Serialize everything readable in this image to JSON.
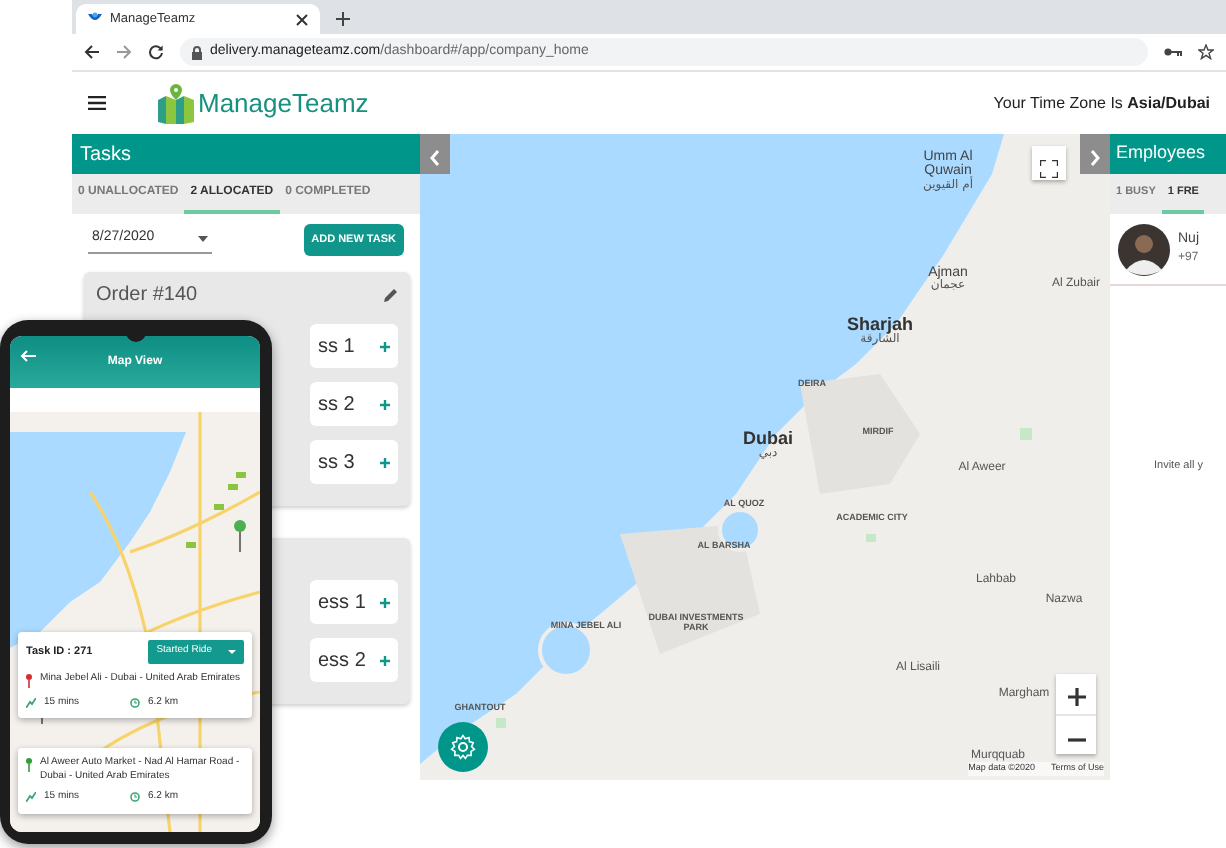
{
  "browser": {
    "tab_title": "ManageTeamz",
    "address_domain": "delivery.manageteamz.com",
    "address_path": "/dashboard#/app/company_home"
  },
  "header": {
    "logo_text": "ManageTeamz",
    "timezone": "Your Time Zone Is **Asia/Dubai**"
  },
  "tasks": {
    "title": "Tasks",
    "tabs": [
      {
        "label": "0 UNALLOCATED",
        "selected": false
      },
      {
        "label": "2 ALLOCATED",
        "selected": true
      },
      {
        "label": "0 COMPLETED",
        "selected": false
      }
    ],
    "date": "8/27/2020",
    "add_button": "ADD NEW TASK",
    "orders": [
      {
        "title": "Order #140",
        "addresses": [
          "ss 1",
          "ss 2",
          "ss 3"
        ]
      },
      {
        "addresses": [
          "ess 1",
          "ess 2"
        ]
      }
    ]
  },
  "map": {
    "labels": [
      {
        "text": "Umm Al Quwain",
        "arabic": "أم القيوين",
        "kind": "town"
      },
      {
        "text": "Ajman",
        "arabic": "عجمان",
        "kind": "town"
      },
      {
        "text": "Al Zubair",
        "kind": "small"
      },
      {
        "text": "Sharjah",
        "arabic": "الشارقة",
        "kind": "city"
      },
      {
        "text": "DEIRA",
        "kind": "district"
      },
      {
        "text": "Dubai",
        "arabic": "دبي",
        "kind": "city"
      },
      {
        "text": "MIRDIF",
        "kind": "district"
      },
      {
        "text": "Al Aweer",
        "kind": "small"
      },
      {
        "text": "AL QUOZ",
        "kind": "district"
      },
      {
        "text": "ACADEMIC CITY",
        "kind": "district"
      },
      {
        "text": "AL BARSHA",
        "kind": "district"
      },
      {
        "text": "MINA JEBEL ALI",
        "kind": "district"
      },
      {
        "text": "DUBAI INVESTMENTS PARK",
        "kind": "district"
      },
      {
        "text": "Lahbab",
        "kind": "small"
      },
      {
        "text": "Nazwa",
        "kind": "small"
      },
      {
        "text": "Al Lisaili",
        "kind": "small"
      },
      {
        "text": "Margham",
        "kind": "small"
      },
      {
        "text": "GHANTOUT",
        "kind": "district"
      },
      {
        "text": "Murqquab",
        "kind": "small"
      }
    ],
    "attribution": "Map data ©2020",
    "terms": "Terms of Use"
  },
  "employees": {
    "title": "Employees",
    "tabs": [
      {
        "label": "1 BUSY",
        "selected": false
      },
      {
        "label": "1 FRE",
        "selected": true
      }
    ],
    "list": [
      {
        "name": "Nuj",
        "phone": "+97"
      }
    ],
    "invite": "Invite all y"
  },
  "phone": {
    "title": "Map View",
    "task_id": "Task ID : 271",
    "status": "Started Ride",
    "stops": [
      {
        "address": "Mina Jebel Ali - Dubai - United Arab Emirates",
        "time": "15 mins",
        "distance": "6.2 km",
        "color": "#d32f2f"
      },
      {
        "address": "Al Aweer Auto Market - Nad Al Hamar Road - Dubai - United Arab Emirates",
        "time": "15 mins",
        "distance": "6.2 km",
        "color": "#2e9e3a"
      }
    ]
  }
}
